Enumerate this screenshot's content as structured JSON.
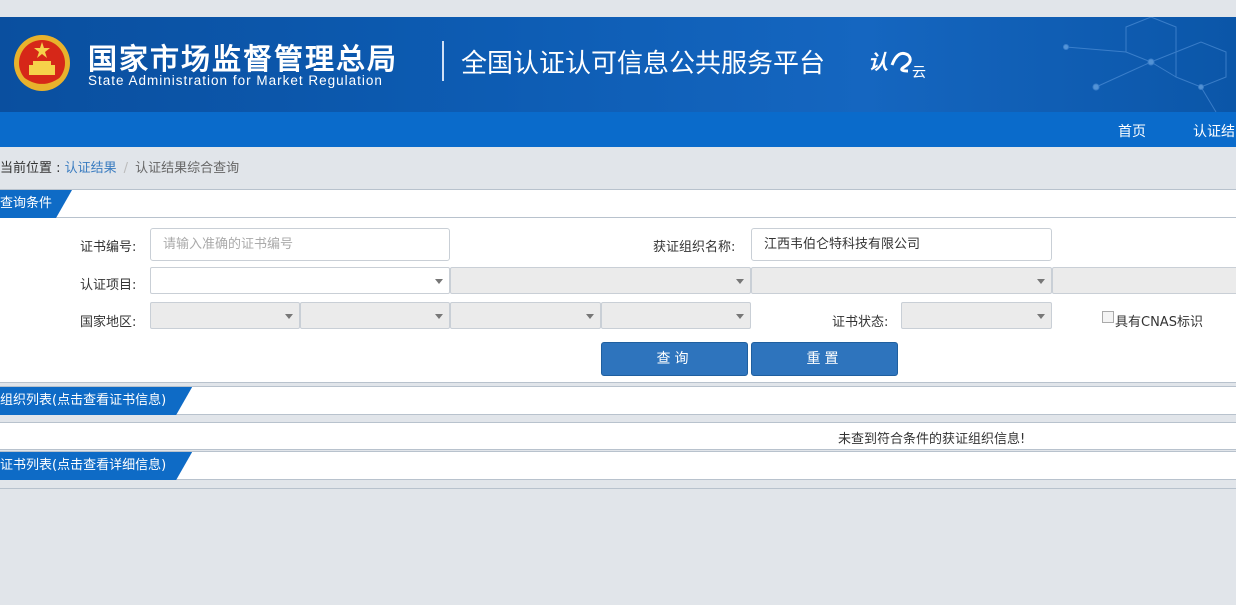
{
  "banner": {
    "agency_cn": "国家市场监督管理总局",
    "agency_en": "State Administration  for  Market Regulation",
    "platform_title": "全国认证认可信息公共服务平台",
    "logo_text_1": "认",
    "logo_text_2": "云"
  },
  "nav": {
    "items": [
      "首页",
      "认证结"
    ]
  },
  "breadcrumb": {
    "prefix": "当前位置 : ",
    "link": "认证结果",
    "separator": "/",
    "current": "认证结果综合查询"
  },
  "query_panel": {
    "title": "查询条件",
    "cert_no_label": "证书编号:",
    "cert_no_placeholder": "请输入准确的证书编号",
    "org_name_label": "获证组织名称:",
    "org_name_value": "江西韦伯仑特科技有限公司",
    "project_label": "认证项目:",
    "region_label": "国家地区:",
    "status_label": "证书状态:",
    "cnas_label": "具有CNAS标识",
    "search_button": "查询",
    "reset_button": "重置"
  },
  "org_list": {
    "title": "组织列表(点击查看证书信息)",
    "empty_message": "未查到符合条件的获证组织信息!"
  },
  "cert_list": {
    "title": "证书列表(点击查看详细信息)"
  },
  "colors": {
    "banner": "#0d5cb3",
    "navbar": "#0a6bcb",
    "tab": "#0e6bc6",
    "button": "#2e74bd",
    "link": "#3a7cc0"
  }
}
